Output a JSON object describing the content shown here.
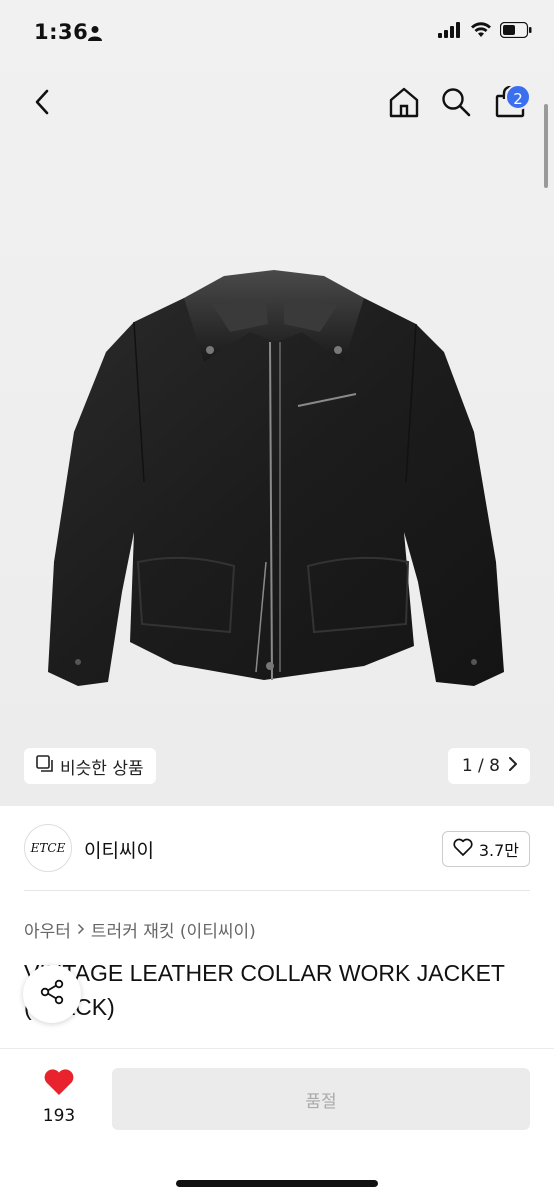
{
  "status_bar": {
    "time": "1:36",
    "icons": [
      "person-icon",
      "cellular-signal-icon",
      "wifi-icon",
      "battery-icon"
    ]
  },
  "nav": {
    "icons": [
      "back-chevron-icon",
      "home-icon",
      "search-icon",
      "shopping-bag-icon"
    ],
    "cart_count": "2"
  },
  "gallery": {
    "similar_label": "비슷한 상품",
    "page_indicator": "1 / 8",
    "image_subject": "black jacket with leather collar"
  },
  "brand": {
    "logo_text": "ETCE",
    "name": "이티씨이",
    "likes": "3.7만"
  },
  "breadcrumb": {
    "category": "아우터",
    "subcategory": "트러커 재킷 (이티씨이)"
  },
  "product": {
    "title": "VINTAGE LEATHER COLLAR WORK JACKET (BLACK)"
  },
  "bottom_bar": {
    "like_count": "193",
    "soldout_label": "품절"
  },
  "colors": {
    "accent_blue": "#3a6ff0",
    "heart_red": "#e8232d",
    "background_gray": "#efefef"
  }
}
